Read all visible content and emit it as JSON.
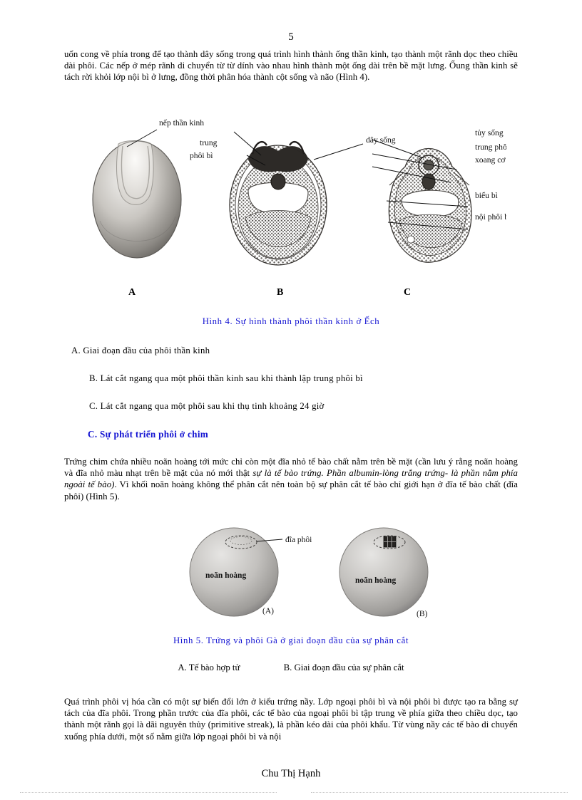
{
  "page": {
    "number": "5",
    "footer": "Chu Thị Hạnh"
  },
  "paragraphs": {
    "p1": "uốn cong về phía trong để tạo thành dây sống trong quá trình hình thành ống thần kinh, tạo thành một rãnh dọc theo chiều dài phôi. Các nếp ở mép rãnh di chuyển từ từ dính vào nhau hình thành một ống dài trên bề mặt lưng. Ốung thần kinh sẽ tách rời khỏi lớp nội bì ở lưng, đồng thời phân hóa thành cột sống và não (Hình 4).",
    "p2_part1": "Trứng chim chứa nhiều noãn hoàng tới mức chỉ còn một đĩa nhỏ tế bào chất nằm trên bề mặt (cần lưu ý rằng noãn hoàng và đĩa nhỏ màu nhạt trên bề mặt của nó mới thật ",
    "p2_italic1": "sự là tế bào trứng. Phần albumin-lòng trắng trứng- là phần nằm phía ngoài tế bào)",
    "p2_part2": ". Vì khối noãn hoàng không thể phân cắt nên toàn bộ sự phân cắt tế bào chỉ giới hạn ở đĩa tế bào chất (đĩa phôi) (Hình 5).",
    "p3": "Quá trình phôi vị hóa cần có một sự biến đổi lớn ở kiểu trứng nầy. Lớp ngoại phôi bì và nội phôi bì được tạo ra bằng sự tách của đĩa phôi. Trong phần trước của đĩa phôi, các tế bào của ngoại phôi bì tập trung về phía giữa theo chiều dọc, tạo thành một rãnh gọi là dãi nguyên thủy (primitive streak), là phần kéo dài của phôi khẩu. Từ vùng nầy các tế bào di chuyển xuống phía dưới, một số nằm giữa lớp ngoại phôi bì và nội"
  },
  "figure4": {
    "caption": "Hình 4. Sự hình thành phôi thần kinh ở Ếch",
    "panel_labels": [
      "A",
      "B",
      "C"
    ],
    "annotations": {
      "nep_than_kinh": "nếp thần kinh",
      "trung": "trung",
      "phoi_bi": "phôi bì",
      "day_song": "dây sống",
      "tuy_song": "tủy sống",
      "trung_phoi_bi": "trung phôi bì",
      "xoang_co_the": "xoang cơ thể",
      "bieu_bi": "biểu bì",
      "noi_phoi_bi": "nội phôi bì"
    },
    "items": [
      "A.  Giai đoạn đầu của phôi thần kinh",
      "B.  Lát cắt ngang qua một phôi thần kinh sau khi thành lập trung phôi bì",
      "C.  Lát cắt ngang qua một phôi sau khi thụ tinh khoảng 24 giờ"
    ]
  },
  "section_heading": "C. Sự phát triển phôi ở chim",
  "figure5": {
    "caption": "Hình 5. Trứng và phôi Gà ở giai đoạn đầu của sự phân cắt",
    "annotations": {
      "dia_phoi": "đĩa phôi",
      "noan_hoang_a": "noãn hoàng",
      "noan_hoang_b": "noãn hoàng",
      "label_a": "(A)",
      "label_b": "(B)"
    },
    "sub_items": [
      "A.   Tế bào hợp tử",
      "B.  Giai đoạn đầu của sự phân cắt"
    ]
  },
  "colors": {
    "caption_blue": "#1414d2",
    "text_black": "#000000",
    "page_background": "#ffffff"
  }
}
